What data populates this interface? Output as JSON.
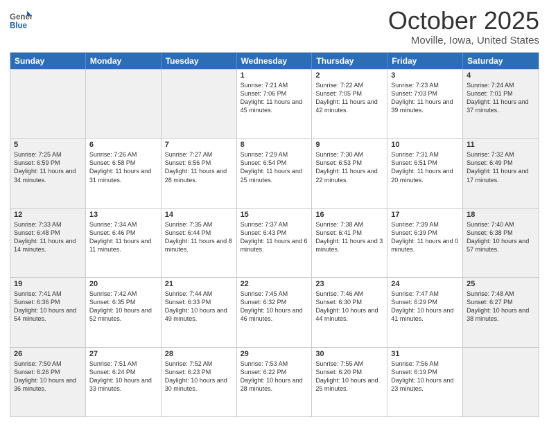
{
  "header": {
    "logo_general": "General",
    "logo_blue": "Blue",
    "month_title": "October 2025",
    "location": "Moville, Iowa, United States"
  },
  "days_of_week": [
    "Sunday",
    "Monday",
    "Tuesday",
    "Wednesday",
    "Thursday",
    "Friday",
    "Saturday"
  ],
  "rows": [
    [
      {
        "day": "",
        "text": "",
        "shaded": true,
        "empty": true
      },
      {
        "day": "",
        "text": "",
        "shaded": true,
        "empty": true
      },
      {
        "day": "",
        "text": "",
        "shaded": true,
        "empty": true
      },
      {
        "day": "1",
        "text": "Sunrise: 7:21 AM\nSunset: 7:06 PM\nDaylight: 11 hours and 45 minutes.",
        "shaded": false
      },
      {
        "day": "2",
        "text": "Sunrise: 7:22 AM\nSunset: 7:05 PM\nDaylight: 11 hours and 42 minutes.",
        "shaded": false
      },
      {
        "day": "3",
        "text": "Sunrise: 7:23 AM\nSunset: 7:03 PM\nDaylight: 11 hours and 39 minutes.",
        "shaded": false
      },
      {
        "day": "4",
        "text": "Sunrise: 7:24 AM\nSunset: 7:01 PM\nDaylight: 11 hours and 37 minutes.",
        "shaded": true
      }
    ],
    [
      {
        "day": "5",
        "text": "Sunrise: 7:25 AM\nSunset: 6:59 PM\nDaylight: 11 hours and 34 minutes.",
        "shaded": true
      },
      {
        "day": "6",
        "text": "Sunrise: 7:26 AM\nSunset: 6:58 PM\nDaylight: 11 hours and 31 minutes.",
        "shaded": false
      },
      {
        "day": "7",
        "text": "Sunrise: 7:27 AM\nSunset: 6:56 PM\nDaylight: 11 hours and 28 minutes.",
        "shaded": false
      },
      {
        "day": "8",
        "text": "Sunrise: 7:29 AM\nSunset: 6:54 PM\nDaylight: 11 hours and 25 minutes.",
        "shaded": false
      },
      {
        "day": "9",
        "text": "Sunrise: 7:30 AM\nSunset: 6:53 PM\nDaylight: 11 hours and 22 minutes.",
        "shaded": false
      },
      {
        "day": "10",
        "text": "Sunrise: 7:31 AM\nSunset: 6:51 PM\nDaylight: 11 hours and 20 minutes.",
        "shaded": false
      },
      {
        "day": "11",
        "text": "Sunrise: 7:32 AM\nSunset: 6:49 PM\nDaylight: 11 hours and 17 minutes.",
        "shaded": true
      }
    ],
    [
      {
        "day": "12",
        "text": "Sunrise: 7:33 AM\nSunset: 6:48 PM\nDaylight: 11 hours and 14 minutes.",
        "shaded": true
      },
      {
        "day": "13",
        "text": "Sunrise: 7:34 AM\nSunset: 6:46 PM\nDaylight: 11 hours and 11 minutes.",
        "shaded": false
      },
      {
        "day": "14",
        "text": "Sunrise: 7:35 AM\nSunset: 6:44 PM\nDaylight: 11 hours and 8 minutes.",
        "shaded": false
      },
      {
        "day": "15",
        "text": "Sunrise: 7:37 AM\nSunset: 6:43 PM\nDaylight: 11 hours and 6 minutes.",
        "shaded": false
      },
      {
        "day": "16",
        "text": "Sunrise: 7:38 AM\nSunset: 6:41 PM\nDaylight: 11 hours and 3 minutes.",
        "shaded": false
      },
      {
        "day": "17",
        "text": "Sunrise: 7:39 AM\nSunset: 6:39 PM\nDaylight: 11 hours and 0 minutes.",
        "shaded": false
      },
      {
        "day": "18",
        "text": "Sunrise: 7:40 AM\nSunset: 6:38 PM\nDaylight: 10 hours and 57 minutes.",
        "shaded": true
      }
    ],
    [
      {
        "day": "19",
        "text": "Sunrise: 7:41 AM\nSunset: 6:36 PM\nDaylight: 10 hours and 54 minutes.",
        "shaded": true
      },
      {
        "day": "20",
        "text": "Sunrise: 7:42 AM\nSunset: 6:35 PM\nDaylight: 10 hours and 52 minutes.",
        "shaded": false
      },
      {
        "day": "21",
        "text": "Sunrise: 7:44 AM\nSunset: 6:33 PM\nDaylight: 10 hours and 49 minutes.",
        "shaded": false
      },
      {
        "day": "22",
        "text": "Sunrise: 7:45 AM\nSunset: 6:32 PM\nDaylight: 10 hours and 46 minutes.",
        "shaded": false
      },
      {
        "day": "23",
        "text": "Sunrise: 7:46 AM\nSunset: 6:30 PM\nDaylight: 10 hours and 44 minutes.",
        "shaded": false
      },
      {
        "day": "24",
        "text": "Sunrise: 7:47 AM\nSunset: 6:29 PM\nDaylight: 10 hours and 41 minutes.",
        "shaded": false
      },
      {
        "day": "25",
        "text": "Sunrise: 7:48 AM\nSunset: 6:27 PM\nDaylight: 10 hours and 38 minutes.",
        "shaded": true
      }
    ],
    [
      {
        "day": "26",
        "text": "Sunrise: 7:50 AM\nSunset: 6:26 PM\nDaylight: 10 hours and 36 minutes.",
        "shaded": true
      },
      {
        "day": "27",
        "text": "Sunrise: 7:51 AM\nSunset: 6:24 PM\nDaylight: 10 hours and 33 minutes.",
        "shaded": false
      },
      {
        "day": "28",
        "text": "Sunrise: 7:52 AM\nSunset: 6:23 PM\nDaylight: 10 hours and 30 minutes.",
        "shaded": false
      },
      {
        "day": "29",
        "text": "Sunrise: 7:53 AM\nSunset: 6:22 PM\nDaylight: 10 hours and 28 minutes.",
        "shaded": false
      },
      {
        "day": "30",
        "text": "Sunrise: 7:55 AM\nSunset: 6:20 PM\nDaylight: 10 hours and 25 minutes.",
        "shaded": false
      },
      {
        "day": "31",
        "text": "Sunrise: 7:56 AM\nSunset: 6:19 PM\nDaylight: 10 hours and 23 minutes.",
        "shaded": false
      },
      {
        "day": "",
        "text": "",
        "shaded": true,
        "empty": true
      }
    ]
  ]
}
